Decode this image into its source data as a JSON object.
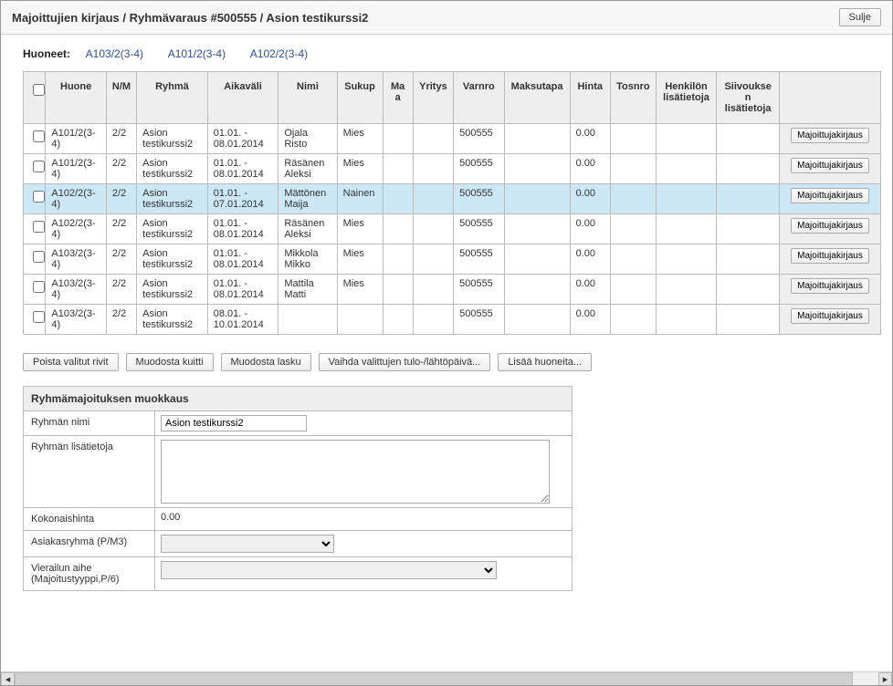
{
  "header": {
    "title": "Majoittujien kirjaus / Ryhmävaraus #500555 / Asion testikurssi2",
    "close": "Sulje"
  },
  "rooms": {
    "label": "Huoneet:",
    "items": [
      "A103/2(3-4)",
      "A101/2(3-4)",
      "A102/2(3-4)"
    ]
  },
  "table": {
    "headers": {
      "huone": "Huone",
      "nm": "N/M",
      "ryhma": "Ryhmä",
      "aikavali": "Aikaväli",
      "nimi": "Nimi",
      "sukup": "Sukup",
      "maa": "Maa",
      "yritys": "Yritys",
      "varnro": "Varnro",
      "maksutapa": "Maksutapa",
      "hinta": "Hinta",
      "tosnro": "Tosnro",
      "henkilon": "Henkilön lisätietoja",
      "siivouksen": "Siivouksen lisätietoja"
    },
    "row_action": "Majoittujakirjaus",
    "rows": [
      {
        "huone": "A101/2(3-4)",
        "nm": "2/2",
        "ryhma": "Asion testikurssi2",
        "aika": "01.01. - 08.01.2014",
        "nimi": "Ojala Risto",
        "sukup": "Mies",
        "maa": "",
        "yritys": "",
        "varnro": "500555",
        "maksu": "",
        "hinta": "0.00",
        "tosnro": "",
        "henk": "",
        "siiv": "",
        "hl": false
      },
      {
        "huone": "A101/2(3-4)",
        "nm": "2/2",
        "ryhma": "Asion testikurssi2",
        "aika": "01.01. - 08.01.2014",
        "nimi": "Räsänen Aleksi",
        "sukup": "Mies",
        "maa": "",
        "yritys": "",
        "varnro": "500555",
        "maksu": "",
        "hinta": "0.00",
        "tosnro": "",
        "henk": "",
        "siiv": "",
        "hl": false
      },
      {
        "huone": "A102/2(3-4)",
        "nm": "2/2",
        "ryhma": "Asion testikurssi2",
        "aika": "01.01. - 07.01.2014",
        "nimi": "Mättönen Maija",
        "sukup": "Nainen",
        "maa": "",
        "yritys": "",
        "varnro": "500555",
        "maksu": "",
        "hinta": "0.00",
        "tosnro": "",
        "henk": "",
        "siiv": "",
        "hl": true
      },
      {
        "huone": "A102/2(3-4)",
        "nm": "2/2",
        "ryhma": "Asion testikurssi2",
        "aika": "01.01. - 08.01.2014",
        "nimi": "Räsänen Aleksi",
        "sukup": "Mies",
        "maa": "",
        "yritys": "",
        "varnro": "500555",
        "maksu": "",
        "hinta": "0.00",
        "tosnro": "",
        "henk": "",
        "siiv": "",
        "hl": false
      },
      {
        "huone": "A103/2(3-4)",
        "nm": "2/2",
        "ryhma": "Asion testikurssi2",
        "aika": "01.01. - 08.01.2014",
        "nimi": "Mikkola Mikko",
        "sukup": "Mies",
        "maa": "",
        "yritys": "",
        "varnro": "500555",
        "maksu": "",
        "hinta": "0.00",
        "tosnro": "",
        "henk": "",
        "siiv": "",
        "hl": false
      },
      {
        "huone": "A103/2(3-4)",
        "nm": "2/2",
        "ryhma": "Asion testikurssi2",
        "aika": "01.01. - 08.01.2014",
        "nimi": "Mattila Matti",
        "sukup": "Mies",
        "maa": "",
        "yritys": "",
        "varnro": "500555",
        "maksu": "",
        "hinta": "0.00",
        "tosnro": "",
        "henk": "",
        "siiv": "",
        "hl": false
      },
      {
        "huone": "A103/2(3-4)",
        "nm": "2/2",
        "ryhma": "Asion testikurssi2",
        "aika": "08.01. - 10.01.2014",
        "nimi": "",
        "sukup": "",
        "maa": "",
        "yritys": "",
        "varnro": "500555",
        "maksu": "",
        "hinta": "0.00",
        "tosnro": "",
        "henk": "",
        "siiv": "",
        "hl": false
      }
    ]
  },
  "toolbar": {
    "delete": "Poista valitut rivit",
    "receipt": "Muodosta kuitti",
    "invoice": "Muodosta lasku",
    "swap": "Vaihda valittujen tulo-/lähtöpäivä...",
    "addrooms": "Lisää huoneita..."
  },
  "edit": {
    "title": "Ryhmämajoituksen muokkaus",
    "name_label": "Ryhmän nimi",
    "name_value": "Asion testikurssi2",
    "info_label": "Ryhmän lisätietoja",
    "info_value": "",
    "total_label": "Kokonaishinta",
    "total_value": "0.00",
    "custgroup_label": "Asiakasryhmä (P/M3)",
    "visit_label": "Vierailun aihe (Majoitustyyppi,P/6)"
  }
}
